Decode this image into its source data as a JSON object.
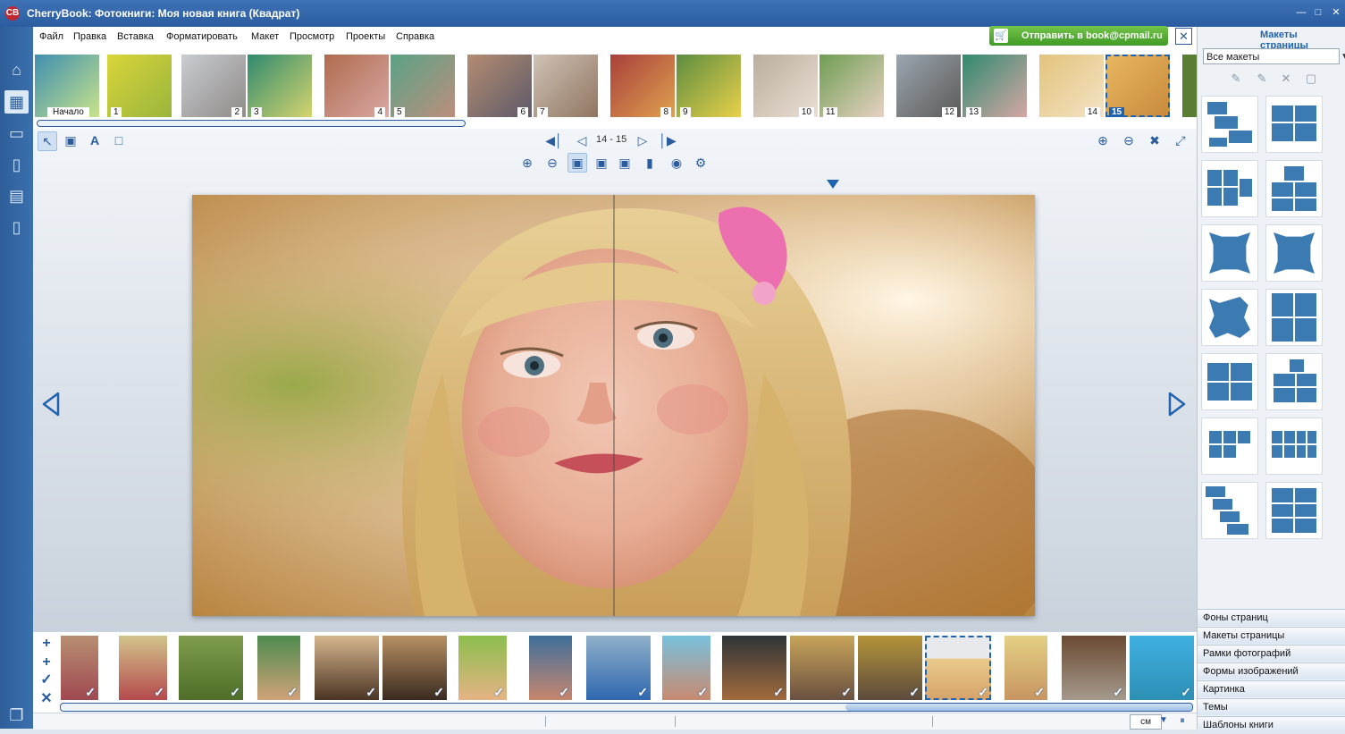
{
  "window": {
    "title": "CherryBook: Фотокниги: Моя новая книга (Квадрат)",
    "logo": "CB"
  },
  "menu": [
    "Файл",
    "Правка",
    "Вставка",
    "Форматировать",
    "Макет",
    "Просмотр",
    "Проекты",
    "Справка"
  ],
  "send_button": {
    "label": "Отправить в book@cpmail.ru"
  },
  "pages": [
    {
      "label": "Начало",
      "colors": [
        "#3e8fb0",
        "#c9e38a"
      ]
    },
    {
      "label": "1",
      "colors": [
        "#d9d53a",
        "#9ab53c"
      ]
    },
    {
      "label": "2",
      "colors": [
        "#c9ccd1",
        "#8f8b88"
      ]
    },
    {
      "label": "3",
      "colors": [
        "#2f8a6f",
        "#d5d46e"
      ]
    },
    {
      "label": "4",
      "colors": [
        "#b06b4e",
        "#d8a8a5"
      ]
    },
    {
      "label": "5",
      "colors": [
        "#5aa386",
        "#bc8e7d"
      ]
    },
    {
      "label": "6",
      "colors": [
        "#b48c73",
        "#5d5a68"
      ]
    },
    {
      "label": "7",
      "colors": [
        "#cfc2b6",
        "#8f7560"
      ]
    },
    {
      "label": "8",
      "colors": [
        "#a8403b",
        "#e0a14f"
      ]
    },
    {
      "label": "9",
      "colors": [
        "#5c8c3f",
        "#e9d14a"
      ]
    },
    {
      "label": "10",
      "colors": [
        "#b9ae9f",
        "#eadfd3"
      ]
    },
    {
      "label": "11",
      "colors": [
        "#6f9d53",
        "#e8d2c3"
      ]
    },
    {
      "label": "12",
      "colors": [
        "#9ba6b0",
        "#5b5a57"
      ]
    },
    {
      "label": "13",
      "colors": [
        "#2f8a6f",
        "#d6a7a4"
      ]
    },
    {
      "label": "14",
      "colors": [
        "#e3c47d",
        "#f3e3c5"
      ]
    },
    {
      "label": "15",
      "colors": [
        "#e9b760",
        "#c88a3c"
      ]
    }
  ],
  "navigation": {
    "page_range": "14 - 15"
  },
  "units": "см",
  "right_panel": {
    "title": "Макеты страницы",
    "filter": "Все макеты",
    "sections": [
      "Фоны страниц",
      "Макеты страницы",
      "Рамки фотографий",
      "Формы изображений",
      "Картинка",
      "Темы",
      "Шаблоны книги"
    ]
  },
  "colors": {
    "accent": "#1f63b0",
    "title_bar": "#2a5c9f",
    "send_green": "#4aa52a"
  }
}
